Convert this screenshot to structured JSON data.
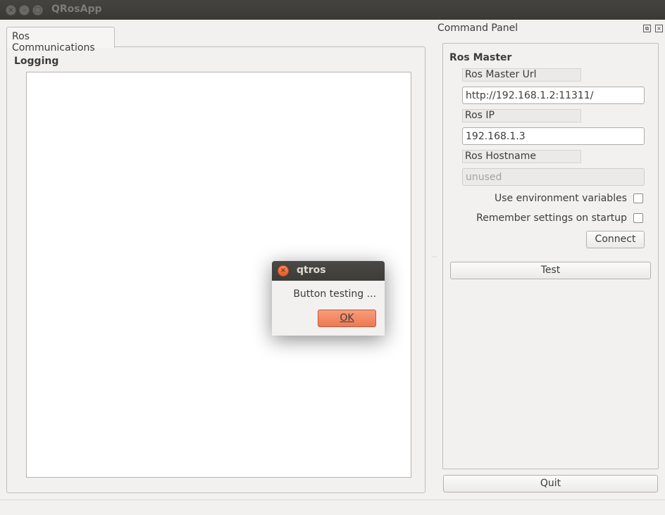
{
  "window": {
    "title": "QRosApp",
    "close_glyph": "×",
    "minimize_glyph": "–",
    "maximize_glyph": "□"
  },
  "left_tabs": {
    "active_tab": "Ros Communications",
    "logging_label": "Logging"
  },
  "command_panel": {
    "title": "Command Panel",
    "float_glyph": "⧉",
    "close_glyph": "×",
    "group_title": "Ros Master",
    "master_url_label": "Ros Master Url",
    "master_url_value": "http://192.168.1.2:11311/",
    "ros_ip_label": "Ros IP",
    "ros_ip_value": "192.168.1.3",
    "hostname_label": "Ros Hostname",
    "hostname_value": "unused",
    "use_env_label": "Use environment variables",
    "use_env_checked": false,
    "remember_label": "Remember settings on startup",
    "remember_checked": false,
    "connect_label": "Connect",
    "test_label": "Test",
    "quit_label": "Quit"
  },
  "dialog": {
    "title": "qtros",
    "close_glyph": "×",
    "message": "Button testing ...",
    "ok_label": "OK"
  },
  "colors": {
    "accent": "#ec7a52",
    "titlebar": "#3d3c38",
    "window_bg": "#f2f1f0"
  }
}
